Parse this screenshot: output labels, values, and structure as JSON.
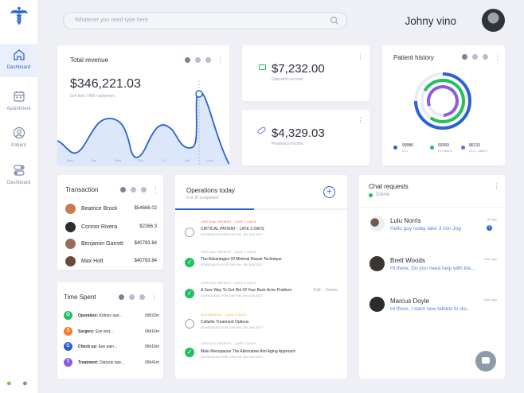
{
  "sidebar": {
    "items": [
      {
        "label": "Dashboard",
        "icon": "home-icon"
      },
      {
        "label": "Apointment",
        "icon": "calendar-icon"
      },
      {
        "label": "Patient",
        "icon": "patient-icon"
      },
      {
        "label": "Dashboard",
        "icon": "toggle-icon"
      }
    ],
    "bottom_icons": [
      "android-icon",
      "apple-icon"
    ]
  },
  "search": {
    "placeholder": "Whatever you need type here"
  },
  "user": {
    "name": "Johny vino"
  },
  "revenue": {
    "title": "Total revenue",
    "amount": "$346,221.03",
    "subtitle": "Got from 1456 customers",
    "days": [
      "Mon",
      "Tue",
      "Wed",
      "Thu",
      "Fri",
      "Sat",
      "Sun"
    ]
  },
  "stats": [
    {
      "amount": "$7,232.00",
      "label": "Operation income"
    },
    {
      "amount": "$4,329.03",
      "label": "Pharmacy income"
    }
  ],
  "patient_history": {
    "title": "Patient history",
    "legend": [
      {
        "value": "99986",
        "label": "ICU",
        "color": "#2a62d4"
      },
      {
        "value": "69359",
        "label": "IN-Patient",
        "color": "#22c05f"
      },
      {
        "value": "86133",
        "label": "OUT- patient",
        "color": "#8a5ce0"
      }
    ]
  },
  "transaction": {
    "title": "Transaction",
    "rows": [
      {
        "name": "Beatrice Brock",
        "amount": "$54668.02"
      },
      {
        "name": "Connor Rivera",
        "amount": "$2266.3"
      },
      {
        "name": "Benjamin Garrett",
        "amount": "$40783.84"
      },
      {
        "name": "Max Holt",
        "amount": "$40783.84"
      }
    ]
  },
  "time_spent": {
    "title": "Time Spent",
    "rows": [
      {
        "letter": "O",
        "kind": "Operation:",
        "desc": "Kidney ope...",
        "hours": "09h23m",
        "color": "#22c05f"
      },
      {
        "letter": "S",
        "kind": "Surgery:",
        "desc": "Eye test...",
        "hours": "06h16m",
        "color": "#ff7a30"
      },
      {
        "letter": "C",
        "kind": "Check up:",
        "desc": "Eye pain...",
        "hours": "06h16m",
        "color": "#2a62d4"
      },
      {
        "letter": "T",
        "kind": "Treatment:",
        "desc": "Dialysis ope...",
        "hours": "05h41m",
        "color": "#8a5ce0"
      }
    ]
  },
  "operations": {
    "title": "Operations today",
    "subtitle": "9 of 10 completed",
    "progress_fraction": 0.46,
    "edit_label": "Edit",
    "delete_label": "Delete",
    "items": [
      {
        "tag": "CRITICAL PATIENT - LATE 2 DAYS",
        "name": "CRITICAL PATIENT - LATE 2 DAYS",
        "schedule": "SCHEDULED FOR 3:00 P.M. ON JUN 2017",
        "done": false,
        "tag_color": "#f04a4a"
      },
      {
        "tag": "CRITICAL PATIENT - LATE 2 DAYS",
        "name": "The Advantages Of Minimal Repair Technique",
        "schedule": "SCHEDULED FOR 3:00 P.M. ON JUN 2017",
        "done": true,
        "tag_color": "#9aa2b3"
      },
      {
        "tag": "CRITICAL PATIENT - LATE 2 DAYS",
        "name": "A Sure Way To Get Rid Of Your Back Ache Problem",
        "schedule": "SCHEDULED FOR 3:00 P.M. ON JUN 2017",
        "done": true,
        "tag_color": "#9aa2b3"
      },
      {
        "tag": "OUTPATIENT - LATE 2 DAYS",
        "name": "Cellulite Treatment Options",
        "schedule": "SCHEDULED FOR 3:00 P.M. ON JUN 2017",
        "done": false,
        "tag_color": "#f0a030"
      },
      {
        "tag": "CRITICAL PATIENT - LATE 2 DAYS",
        "name": "Male Menopause The Alternative Anti Aging Approach",
        "schedule": "SCHEDULED FOR 3:00 P.M. ON JUN 2017",
        "done": true,
        "tag_color": "#9aa2b3"
      }
    ]
  },
  "chat": {
    "title": "Chat requests",
    "status": "Online",
    "unread_badge": "1",
    "items": [
      {
        "name": "Lulu Norris",
        "message": "Hello guy today take 3 min Jog",
        "time": "5h ago"
      },
      {
        "name": "Brett Woods",
        "message": "Hi there, Do you need help with the...",
        "time": "3min ago"
      },
      {
        "name": "Marcus Doyle",
        "message": "Hi there, I want new tablets fo dis...",
        "time": "3min ago"
      }
    ]
  }
}
